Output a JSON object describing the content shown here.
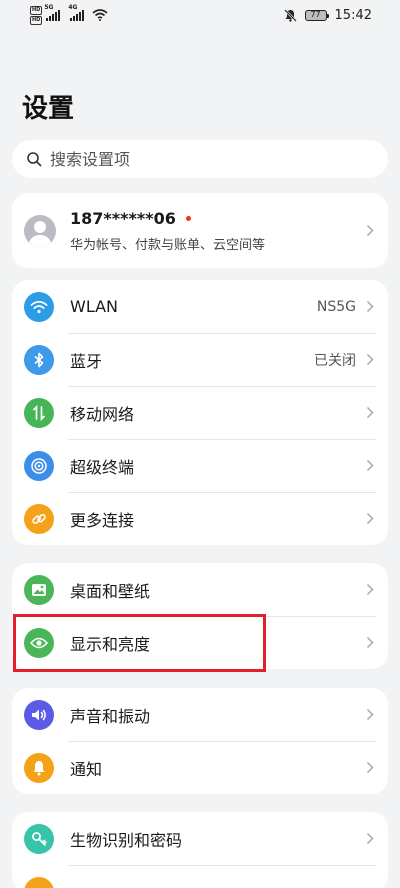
{
  "status_bar": {
    "time": "15:42",
    "battery": "77",
    "sim1_net": "5G",
    "sim2_net": "4G",
    "hd1": "HD",
    "hd2": "HD"
  },
  "page": {
    "title": "设置"
  },
  "search": {
    "placeholder": "搜索设置项"
  },
  "account": {
    "name": "187******06",
    "subtitle": "华为帐号、付款与账单、云空间等"
  },
  "groups": [
    {
      "items": [
        {
          "label": "WLAN",
          "value": "NS5G",
          "icon": "wifi-icon",
          "color": "#2b9de8"
        },
        {
          "label": "蓝牙",
          "value": "已关闭",
          "icon": "bluetooth-icon",
          "color": "#3d9be9"
        },
        {
          "label": "移动网络",
          "value": "",
          "icon": "mobile-data-icon",
          "color": "#46b558"
        },
        {
          "label": "超级终端",
          "value": "",
          "icon": "super-device-icon",
          "color": "#3d8ee9"
        },
        {
          "label": "更多连接",
          "value": "",
          "icon": "link-icon",
          "color": "#f5a21b"
        }
      ]
    },
    {
      "items": [
        {
          "label": "桌面和壁纸",
          "value": "",
          "icon": "wallpaper-icon",
          "color": "#4bb657"
        },
        {
          "label": "显示和亮度",
          "value": "",
          "icon": "eye-icon",
          "color": "#4bb657"
        }
      ]
    },
    {
      "items": [
        {
          "label": "声音和振动",
          "value": "",
          "icon": "sound-icon",
          "color": "#5b5ce6"
        },
        {
          "label": "通知",
          "value": "",
          "icon": "bell-icon",
          "color": "#f5a21b"
        }
      ]
    },
    {
      "items": [
        {
          "label": "生物识别和密码",
          "value": "",
          "icon": "key-icon",
          "color": "#37c4a8"
        }
      ]
    }
  ]
}
